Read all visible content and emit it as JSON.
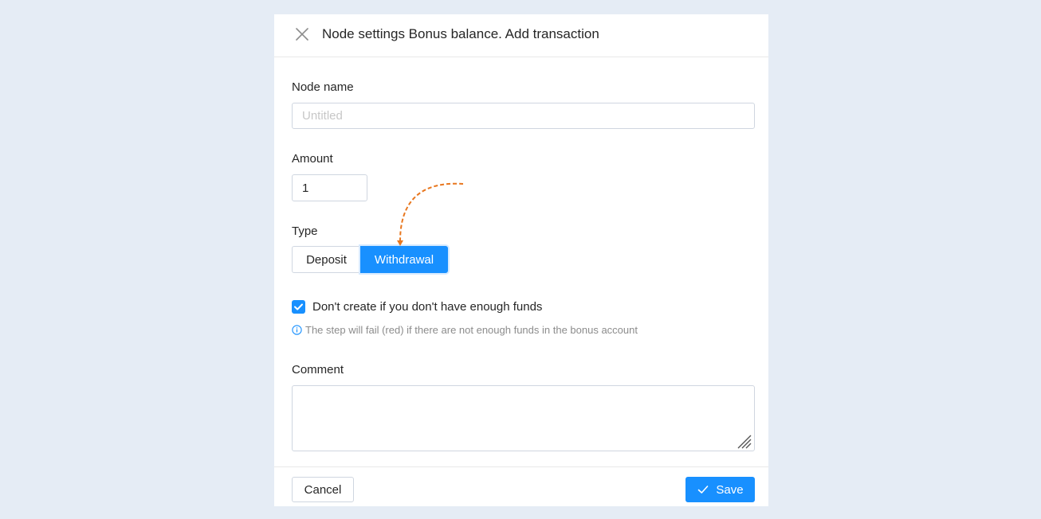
{
  "dialog": {
    "title": "Node settings Bonus balance. Add transaction",
    "close_icon": "close-icon"
  },
  "node_name": {
    "label": "Node name",
    "value": "",
    "placeholder": "Untitled"
  },
  "amount": {
    "label": "Amount",
    "value": "1"
  },
  "type": {
    "label": "Type",
    "options": [
      "Deposit",
      "Withdrawal"
    ],
    "selected": "Withdrawal"
  },
  "funds_check": {
    "checked": true,
    "label": "Don't create if you don't have enough funds",
    "hint_icon": "info-circle-icon",
    "hint": "The step will fail (red) if there are not enough funds in the bonus account"
  },
  "comment": {
    "label": "Comment",
    "value": ""
  },
  "footer": {
    "cancel_label": "Cancel",
    "save_label": "Save",
    "save_icon": "check-icon"
  },
  "colors": {
    "accent": "#1890ff",
    "annotation_arrow": "#e8771f",
    "background": "#e5ecf5"
  }
}
